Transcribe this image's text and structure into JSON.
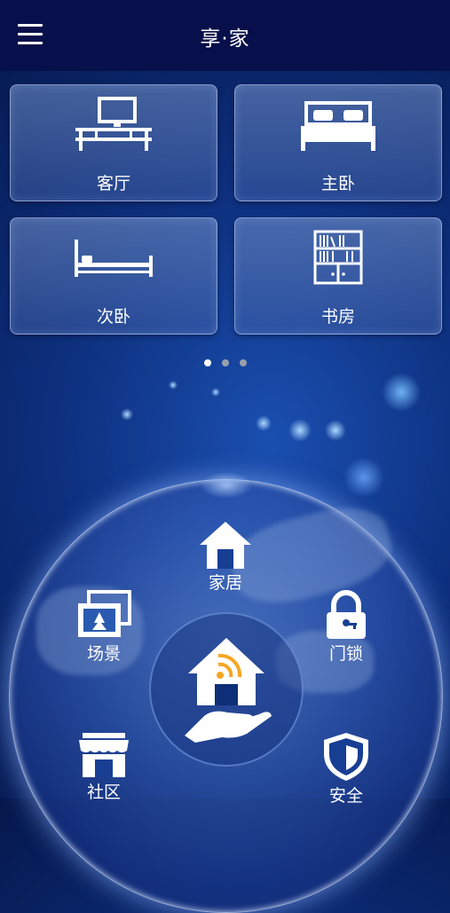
{
  "header": {
    "title": "享·家",
    "menu_icon": "hamburger-menu-icon"
  },
  "rooms": [
    {
      "label": "客厅",
      "icon": "tv-stand-icon"
    },
    {
      "label": "主卧",
      "icon": "double-bed-icon"
    },
    {
      "label": "次卧",
      "icon": "single-bed-icon"
    },
    {
      "label": "书房",
      "icon": "bookshelf-icon"
    }
  ],
  "pager": {
    "count": 3,
    "active_index": 0
  },
  "nav": {
    "home": {
      "label": "家居",
      "icon": "house-icon"
    },
    "scene": {
      "label": "场景",
      "icon": "picture-frames-icon"
    },
    "lock": {
      "label": "门锁",
      "icon": "padlock-icon"
    },
    "community": {
      "label": "社区",
      "icon": "storefront-icon"
    },
    "security": {
      "label": "安全",
      "icon": "shield-icon"
    },
    "center": {
      "icon": "hand-holding-wifi-house-icon"
    }
  },
  "colors": {
    "topbar": "#07104a",
    "accent_orange": "#f5a623",
    "background": "#0d2f7d"
  }
}
